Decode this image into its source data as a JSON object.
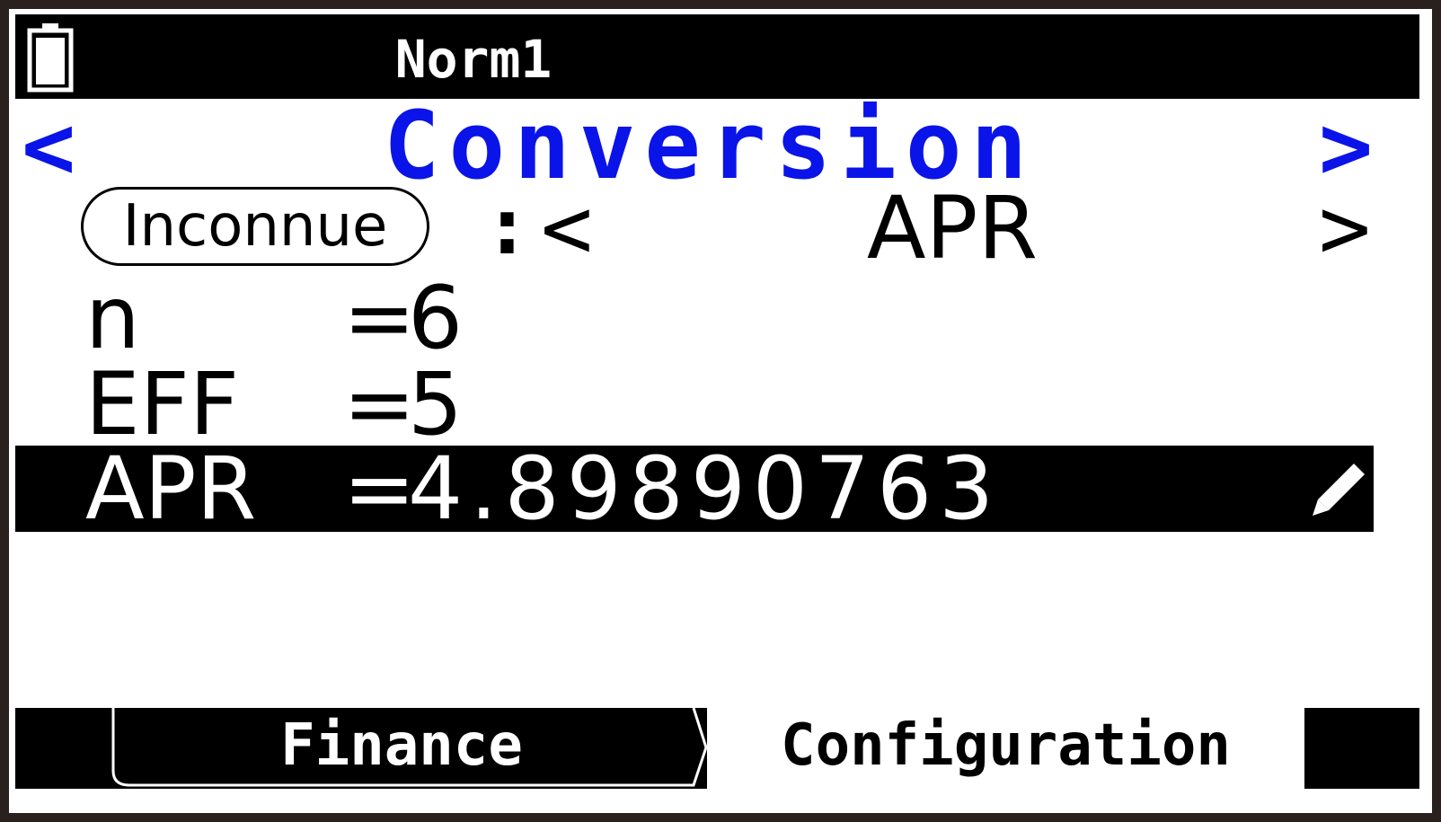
{
  "status_bar": {
    "mode": "Norm1",
    "battery_icon": "battery-icon"
  },
  "title": {
    "text": "Conversion",
    "left_arrow": "<",
    "right_arrow": ">"
  },
  "unknown_selector": {
    "label": "Inconnue",
    "colon": ":",
    "left_arrow": "<",
    "value": "APR",
    "right_arrow": ">"
  },
  "variables": [
    {
      "name": "n",
      "equals": "=",
      "value": "6"
    },
    {
      "name": "EFF",
      "equals": "=",
      "value": "5"
    },
    {
      "name": "APR",
      "equals": "=",
      "value": "4.89890763",
      "selected": true,
      "edit_icon": "pencil-icon"
    }
  ],
  "function_bar": {
    "f1_label": "Finance",
    "f2_label": "Configuration"
  },
  "colors": {
    "accent_blue": "#0a14e8",
    "background": "#ffffff",
    "bezel": "#2a211f",
    "bar": "#000000"
  }
}
